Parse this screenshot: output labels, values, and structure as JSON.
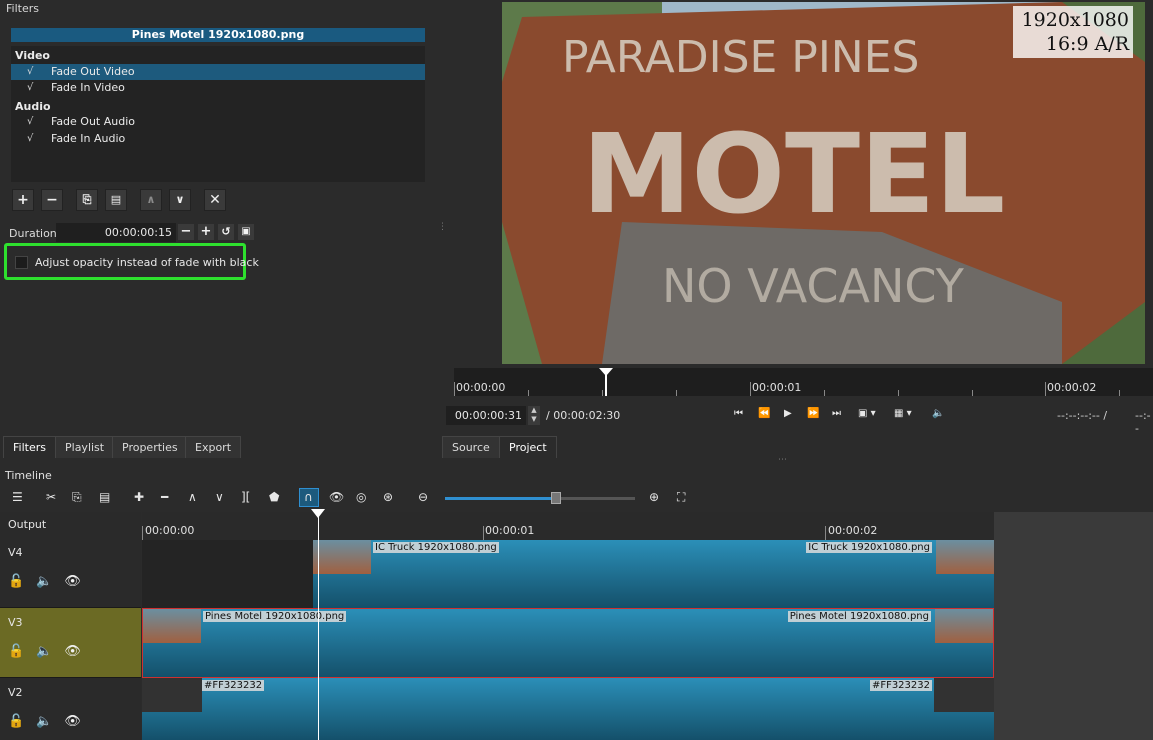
{
  "filters": {
    "title": "Filters",
    "window_buttons": "⧉ ⊠",
    "clip_name": "Pines Motel 1920x1080.png",
    "sections": [
      {
        "name": "Video",
        "items": [
          {
            "label": "Fade Out Video",
            "checked": "√",
            "selected": true
          },
          {
            "label": "Fade In Video",
            "checked": "√",
            "selected": false
          }
        ]
      },
      {
        "name": "Audio",
        "items": [
          {
            "label": "Fade Out Audio",
            "checked": "√",
            "selected": false
          },
          {
            "label": "Fade In Audio",
            "checked": "√",
            "selected": false
          }
        ]
      }
    ],
    "duration_label": "Duration",
    "duration_value": "00:00:00:15",
    "opacity_option": "Adjust opacity instead of fade with black",
    "highlight_color": "#2ee02e"
  },
  "left_tabs": [
    "Filters",
    "Playlist",
    "Properties",
    "Export"
  ],
  "player": {
    "overlay_line1": "1920x1080",
    "overlay_line2": "16:9 A/R",
    "ruler_labels": [
      "00:00:00",
      "00:00:01",
      "00:00:02"
    ],
    "timecode": "00:00:00:31",
    "total_duration": "/ 00:00:02:30",
    "in_point": "--:--:--:-- /",
    "out_point": "--:--",
    "tabs": [
      "Source",
      "Project"
    ]
  },
  "timeline": {
    "title": "Timeline",
    "ruler_labels": [
      "00:00:00",
      "00:00:01",
      "00:00:02"
    ],
    "output_label": "Output",
    "tracks": [
      {
        "name": "V4",
        "clip_start_label": "IC Truck 1920x1080.png",
        "clip_end_label": "IC Truck 1920x1080.png"
      },
      {
        "name": "V3",
        "clip_start_label": "Pines Motel 1920x1080.png",
        "clip_end_label": "Pines Motel 1920x1080.png"
      },
      {
        "name": "V2",
        "clip_start_label": "#FF323232",
        "clip_end_label": "#FF323232"
      }
    ],
    "selected_track_color": "#6b6a24",
    "accent": "#2f8fd0"
  }
}
